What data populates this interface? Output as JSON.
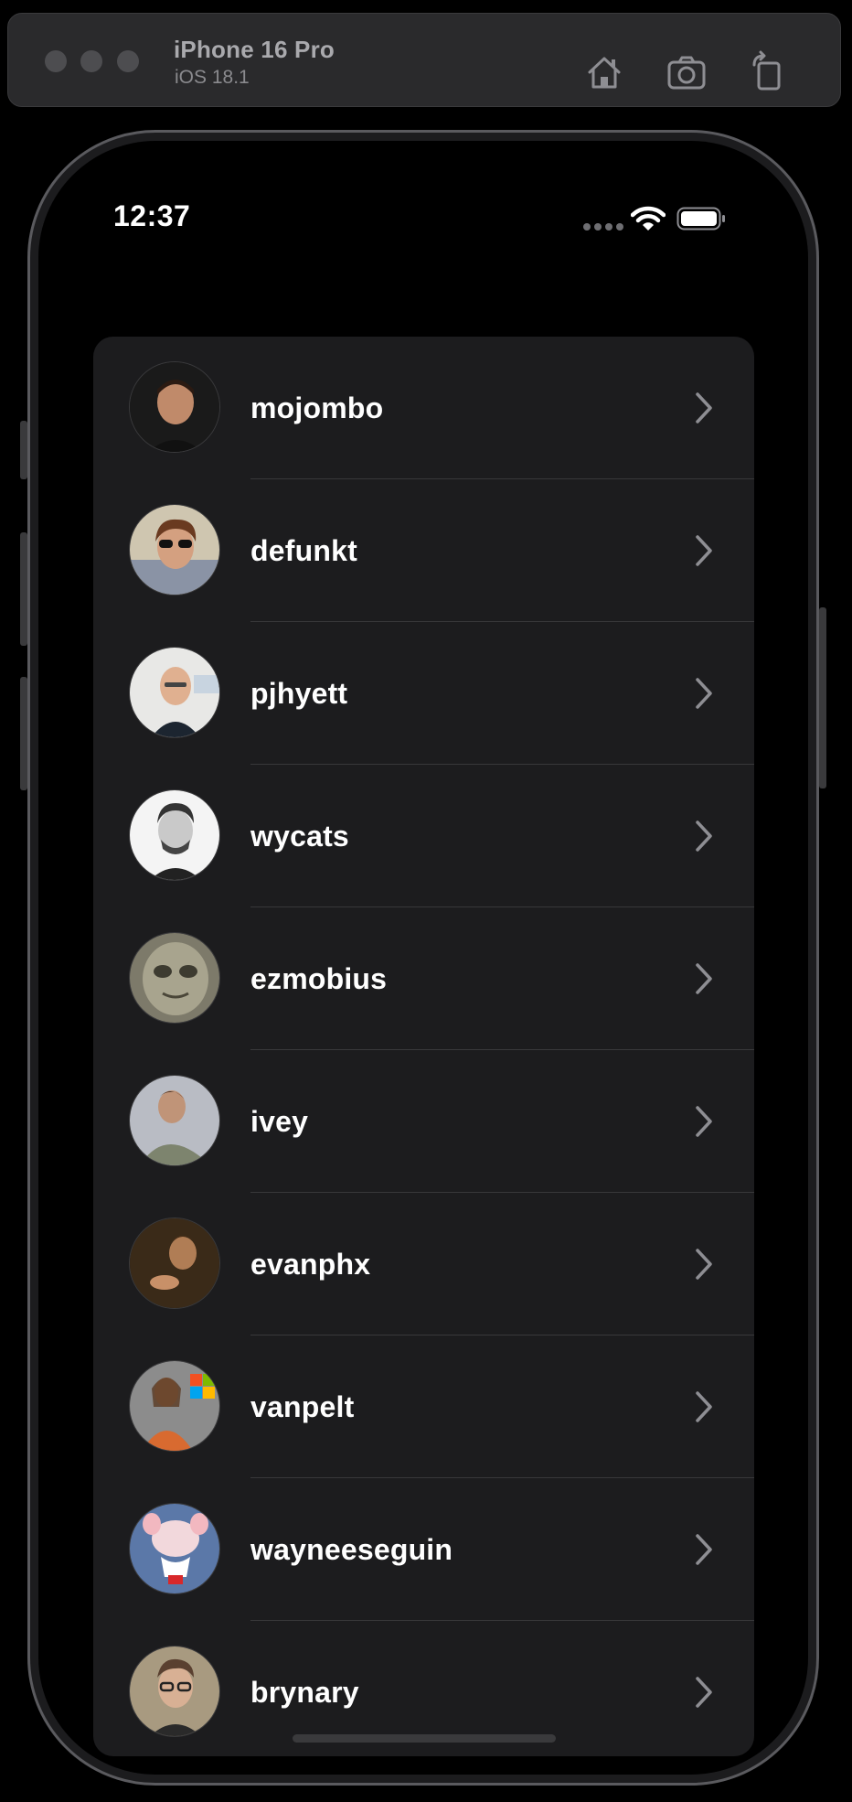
{
  "simulator": {
    "device_name": "iPhone 16 Pro",
    "os_version": "iOS 18.1",
    "toolbar_icons": [
      "home-icon",
      "screenshot-icon",
      "rotate-icon"
    ]
  },
  "status_bar": {
    "time": "12:37",
    "icons": [
      "cellular-dots-icon",
      "wifi-icon",
      "battery-icon"
    ]
  },
  "users": [
    {
      "login": "mojombo"
    },
    {
      "login": "defunkt"
    },
    {
      "login": "pjhyett"
    },
    {
      "login": "wycats"
    },
    {
      "login": "ezmobius"
    },
    {
      "login": "ivey"
    },
    {
      "login": "evanphx"
    },
    {
      "login": "vanpelt"
    },
    {
      "login": "wayneeseguin"
    },
    {
      "login": "brynary"
    }
  ],
  "colors": {
    "background": "#000000",
    "list_background": "#1c1c1e",
    "separator": "#38383a",
    "text": "#ffffff",
    "chevron": "#8e8e93"
  }
}
